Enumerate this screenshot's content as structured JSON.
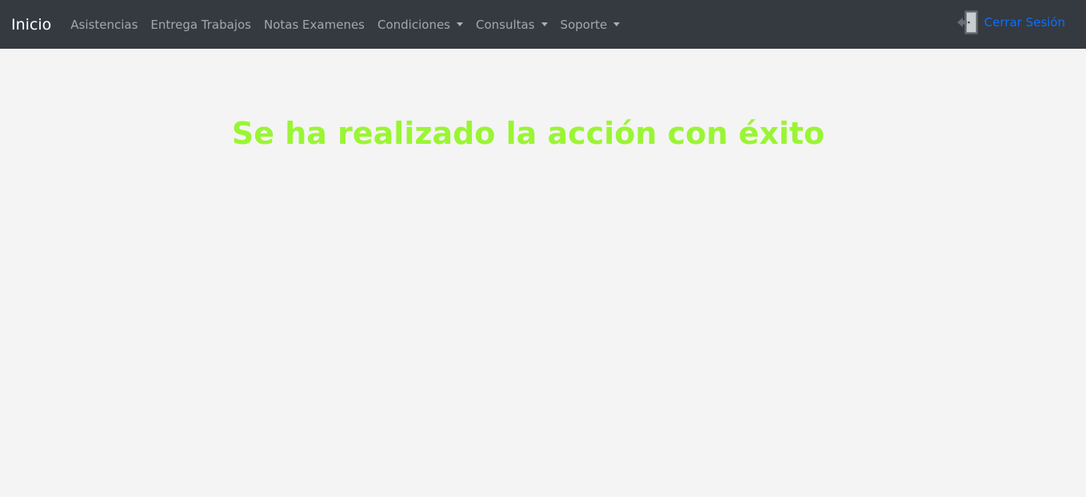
{
  "navbar": {
    "brand": "Inicio",
    "links": [
      {
        "label": "Asistencias"
      },
      {
        "label": "Entrega Trabajos"
      },
      {
        "label": "Notas Examenes"
      }
    ],
    "dropdowns": [
      {
        "label": "Condiciones"
      },
      {
        "label": "Consultas"
      },
      {
        "label": "Soporte"
      }
    ],
    "logout": {
      "label": "Cerrar Sesión",
      "icon": "door-exit-icon"
    }
  },
  "main": {
    "message": "Se ha realizado la acción con éxito"
  },
  "colors": {
    "navbar_bg": "#343a40",
    "page_bg": "#f4f4f4",
    "success_text": "#9af533",
    "link_blue": "#0d6efd"
  }
}
